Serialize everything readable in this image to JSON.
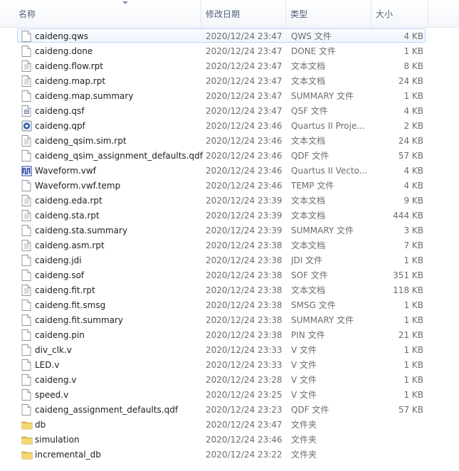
{
  "columns": {
    "name": "名称",
    "date": "修改日期",
    "type": "类型",
    "size": "大小"
  },
  "files": [
    {
      "name": "caideng.qws",
      "date": "2020/12/24 23:47",
      "type": "QWS 文件",
      "size": "4 KB",
      "icon": "blank-file-icon",
      "selected": true
    },
    {
      "name": "caideng.done",
      "date": "2020/12/24 23:47",
      "type": "DONE 文件",
      "size": "1 KB",
      "icon": "blank-file-icon"
    },
    {
      "name": "caideng.flow.rpt",
      "date": "2020/12/24 23:47",
      "type": "文本文档",
      "size": "8 KB",
      "icon": "text-file-icon"
    },
    {
      "name": "caideng.map.rpt",
      "date": "2020/12/24 23:47",
      "type": "文本文档",
      "size": "24 KB",
      "icon": "text-file-icon"
    },
    {
      "name": "caideng.map.summary",
      "date": "2020/12/24 23:47",
      "type": "SUMMARY 文件",
      "size": "1 KB",
      "icon": "blank-file-icon"
    },
    {
      "name": "caideng.qsf",
      "date": "2020/12/24 23:47",
      "type": "QSF 文件",
      "size": "4 KB",
      "icon": "settings-file-icon"
    },
    {
      "name": "caideng.qpf",
      "date": "2020/12/24 23:46",
      "type": "Quartus II Proje...",
      "size": "2 KB",
      "icon": "quartus-project-icon"
    },
    {
      "name": "caideng_qsim.sim.rpt",
      "date": "2020/12/24 23:46",
      "type": "文本文档",
      "size": "24 KB",
      "icon": "text-file-icon"
    },
    {
      "name": "caideng_qsim_assignment_defaults.qdf",
      "date": "2020/12/24 23:46",
      "type": "QDF 文件",
      "size": "57 KB",
      "icon": "blank-file-icon"
    },
    {
      "name": "Waveform.vwf",
      "date": "2020/12/24 23:46",
      "type": "Quartus II Vecto...",
      "size": "4 KB",
      "icon": "waveform-icon"
    },
    {
      "name": "Waveform.vwf.temp",
      "date": "2020/12/24 23:46",
      "type": "TEMP 文件",
      "size": "4 KB",
      "icon": "blank-file-icon"
    },
    {
      "name": "caideng.eda.rpt",
      "date": "2020/12/24 23:39",
      "type": "文本文档",
      "size": "9 KB",
      "icon": "text-file-icon"
    },
    {
      "name": "caideng.sta.rpt",
      "date": "2020/12/24 23:39",
      "type": "文本文档",
      "size": "444 KB",
      "icon": "text-file-icon"
    },
    {
      "name": "caideng.sta.summary",
      "date": "2020/12/24 23:39",
      "type": "SUMMARY 文件",
      "size": "3 KB",
      "icon": "blank-file-icon"
    },
    {
      "name": "caideng.asm.rpt",
      "date": "2020/12/24 23:38",
      "type": "文本文档",
      "size": "7 KB",
      "icon": "text-file-icon"
    },
    {
      "name": "caideng.jdi",
      "date": "2020/12/24 23:38",
      "type": "JDI 文件",
      "size": "1 KB",
      "icon": "blank-file-icon"
    },
    {
      "name": "caideng.sof",
      "date": "2020/12/24 23:38",
      "type": "SOF 文件",
      "size": "351 KB",
      "icon": "blank-file-icon"
    },
    {
      "name": "caideng.fit.rpt",
      "date": "2020/12/24 23:38",
      "type": "文本文档",
      "size": "118 KB",
      "icon": "text-file-icon"
    },
    {
      "name": "caideng.fit.smsg",
      "date": "2020/12/24 23:38",
      "type": "SMSG 文件",
      "size": "1 KB",
      "icon": "blank-file-icon"
    },
    {
      "name": "caideng.fit.summary",
      "date": "2020/12/24 23:38",
      "type": "SUMMARY 文件",
      "size": "1 KB",
      "icon": "blank-file-icon"
    },
    {
      "name": "caideng.pin",
      "date": "2020/12/24 23:38",
      "type": "PIN 文件",
      "size": "21 KB",
      "icon": "blank-file-icon"
    },
    {
      "name": "div_clk.v",
      "date": "2020/12/24 23:33",
      "type": "V 文件",
      "size": "1 KB",
      "icon": "blank-file-icon"
    },
    {
      "name": "LED.v",
      "date": "2020/12/24 23:33",
      "type": "V 文件",
      "size": "1 KB",
      "icon": "blank-file-icon"
    },
    {
      "name": "caideng.v",
      "date": "2020/12/24 23:28",
      "type": "V 文件",
      "size": "1 KB",
      "icon": "blank-file-icon"
    },
    {
      "name": "speed.v",
      "date": "2020/12/24 23:25",
      "type": "V 文件",
      "size": "1 KB",
      "icon": "blank-file-icon"
    },
    {
      "name": "caideng_assignment_defaults.qdf",
      "date": "2020/12/24 23:23",
      "type": "QDF 文件",
      "size": "57 KB",
      "icon": "blank-file-icon"
    },
    {
      "name": "db",
      "date": "2020/12/24 23:47",
      "type": "文件夹",
      "size": "",
      "icon": "folder-icon"
    },
    {
      "name": "simulation",
      "date": "2020/12/24 23:46",
      "type": "文件夹",
      "size": "",
      "icon": "folder-icon"
    },
    {
      "name": "incremental_db",
      "date": "2020/12/24 23:22",
      "type": "文件夹",
      "size": "",
      "icon": "folder-icon"
    }
  ],
  "colors": {
    "selection_border": "#b8d6fb",
    "header_text": "#4c607a",
    "folder": "#e8c04a",
    "waveform": "#1f3f9c"
  }
}
